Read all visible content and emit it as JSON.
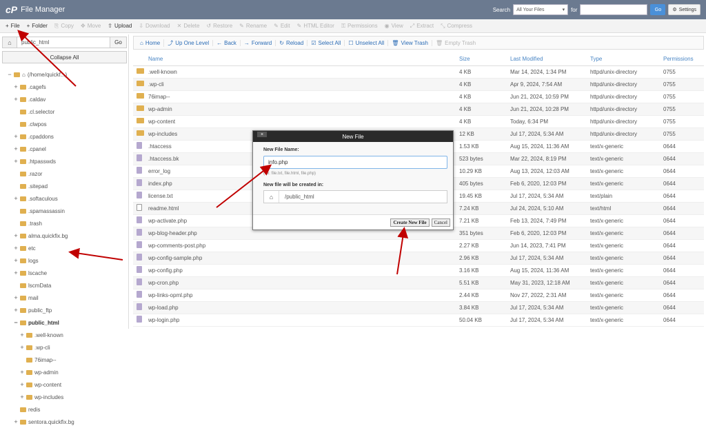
{
  "app": {
    "logo_text": "cP",
    "title": "File Manager"
  },
  "search": {
    "label": "Search",
    "scope": "All Your Files",
    "for_label": "for",
    "go": "Go",
    "settings": "Settings"
  },
  "toolbar": [
    {
      "label": "File",
      "icon": "plus-icon",
      "disabled": false
    },
    {
      "label": "Folder",
      "icon": "plus-icon",
      "disabled": false
    },
    {
      "label": "Copy",
      "icon": "copy-icon",
      "disabled": true
    },
    {
      "label": "Move",
      "icon": "move-icon",
      "disabled": true
    },
    {
      "label": "Upload",
      "icon": "upload-icon",
      "disabled": false
    },
    {
      "label": "Download",
      "icon": "download-icon",
      "disabled": true
    },
    {
      "label": "Delete",
      "icon": "delete-icon",
      "disabled": true
    },
    {
      "label": "Restore",
      "icon": "restore-icon",
      "disabled": true
    },
    {
      "label": "Rename",
      "icon": "rename-icon",
      "disabled": true
    },
    {
      "label": "Edit",
      "icon": "edit-icon",
      "disabled": true
    },
    {
      "label": "HTML Editor",
      "icon": "html-editor-icon",
      "disabled": true
    },
    {
      "label": "Permissions",
      "icon": "key-icon",
      "disabled": true
    },
    {
      "label": "View",
      "icon": "eye-icon",
      "disabled": true
    },
    {
      "label": "Extract",
      "icon": "extract-icon",
      "disabled": true
    },
    {
      "label": "Compress",
      "icon": "compress-icon",
      "disabled": true
    }
  ],
  "left": {
    "path_value": "public_html",
    "go": "Go",
    "collapse_all": "Collapse All"
  },
  "tree": [
    {
      "label": "(/home/quickf...)",
      "level": 0,
      "toggle": "−",
      "bold": false,
      "home": true
    },
    {
      "label": ".cagefs",
      "level": 1,
      "toggle": "+"
    },
    {
      "label": ".caldav",
      "level": 1,
      "toggle": "+"
    },
    {
      "label": ".cl.selector",
      "level": 1,
      "toggle": ""
    },
    {
      "label": ".clwpos",
      "level": 1,
      "toggle": ""
    },
    {
      "label": ".cpaddons",
      "level": 1,
      "toggle": "+"
    },
    {
      "label": ".cpanel",
      "level": 1,
      "toggle": "+"
    },
    {
      "label": ".htpasswds",
      "level": 1,
      "toggle": "+"
    },
    {
      "label": ".razor",
      "level": 1,
      "toggle": ""
    },
    {
      "label": ".sitepad",
      "level": 1,
      "toggle": ""
    },
    {
      "label": ".softaculous",
      "level": 1,
      "toggle": "+"
    },
    {
      "label": ".spamassassin",
      "level": 1,
      "toggle": ""
    },
    {
      "label": ".trash",
      "level": 1,
      "toggle": ""
    },
    {
      "label": "alma.quickfix.bg",
      "level": 1,
      "toggle": "+"
    },
    {
      "label": "etc",
      "level": 1,
      "toggle": "+"
    },
    {
      "label": "logs",
      "level": 1,
      "toggle": "+"
    },
    {
      "label": "lscache",
      "level": 1,
      "toggle": "+"
    },
    {
      "label": "lscmData",
      "level": 1,
      "toggle": ""
    },
    {
      "label": "mail",
      "level": 1,
      "toggle": "+"
    },
    {
      "label": "public_ftp",
      "level": 1,
      "toggle": "+"
    },
    {
      "label": "public_html",
      "level": 1,
      "toggle": "−",
      "bold": true
    },
    {
      "label": ".well-known",
      "level": 2,
      "toggle": "+"
    },
    {
      "label": ".wp-cli",
      "level": 2,
      "toggle": "+"
    },
    {
      "label": "76imap--",
      "level": 2,
      "toggle": ""
    },
    {
      "label": "wp-admin",
      "level": 2,
      "toggle": "+"
    },
    {
      "label": "wp-content",
      "level": 2,
      "toggle": "+"
    },
    {
      "label": "wp-includes",
      "level": 2,
      "toggle": "+"
    },
    {
      "label": "redis",
      "level": 1,
      "toggle": ""
    },
    {
      "label": "sentora.quickfix.bg",
      "level": 1,
      "toggle": "+"
    }
  ],
  "nav": [
    {
      "label": "Home",
      "icon": "home-icon",
      "disabled": false
    },
    {
      "label": "Up One Level",
      "icon": "up-level-icon",
      "disabled": false
    },
    {
      "label": "Back",
      "icon": "back-icon",
      "disabled": false
    },
    {
      "label": "Forward",
      "icon": "forward-icon",
      "disabled": false
    },
    {
      "label": "Reload",
      "icon": "reload-icon",
      "disabled": false
    },
    {
      "label": "Select All",
      "icon": "checkbox-checked-icon",
      "disabled": false
    },
    {
      "label": "Unselect All",
      "icon": "checkbox-icon",
      "disabled": false
    },
    {
      "label": "View Trash",
      "icon": "trash-icon",
      "disabled": false
    },
    {
      "label": "Empty Trash",
      "icon": "trash-icon",
      "disabled": true
    }
  ],
  "table": {
    "columns": [
      "Name",
      "Size",
      "Last Modified",
      "Type",
      "Permissions"
    ],
    "rows": [
      {
        "icon": "folder",
        "name": ".well-known",
        "size": "4 KB",
        "modified": "Mar 14, 2024, 1:34 PM",
        "type": "httpd/unix-directory",
        "perm": "0755"
      },
      {
        "icon": "folder",
        "name": ".wp-cli",
        "size": "4 KB",
        "modified": "Apr 9, 2024, 7:54 AM",
        "type": "httpd/unix-directory",
        "perm": "0755"
      },
      {
        "icon": "folder",
        "name": "76imap--",
        "size": "4 KB",
        "modified": "Jun 21, 2024, 10:59 PM",
        "type": "httpd/unix-directory",
        "perm": "0755"
      },
      {
        "icon": "folder",
        "name": "wp-admin",
        "size": "4 KB",
        "modified": "Jun 21, 2024, 10:28 PM",
        "type": "httpd/unix-directory",
        "perm": "0755"
      },
      {
        "icon": "folder",
        "name": "wp-content",
        "size": "4 KB",
        "modified": "Today, 6:34 PM",
        "type": "httpd/unix-directory",
        "perm": "0755"
      },
      {
        "icon": "folder",
        "name": "wp-includes",
        "size": "12 KB",
        "modified": "Jul 17, 2024, 5:34 AM",
        "type": "httpd/unix-directory",
        "perm": "0755"
      },
      {
        "icon": "file",
        "name": ".htaccess",
        "size": "1.53 KB",
        "modified": "Aug 15, 2024, 11:36 AM",
        "type": "text/x-generic",
        "perm": "0644"
      },
      {
        "icon": "file",
        "name": ".htaccess.bk",
        "size": "523 bytes",
        "modified": "Mar 22, 2024, 8:19 PM",
        "type": "text/x-generic",
        "perm": "0644"
      },
      {
        "icon": "file",
        "name": "error_log",
        "size": "10.29 KB",
        "modified": "Aug 13, 2024, 12:03 AM",
        "type": "text/x-generic",
        "perm": "0644"
      },
      {
        "icon": "file",
        "name": "index.php",
        "size": "405 bytes",
        "modified": "Feb 6, 2020, 12:03 PM",
        "type": "text/x-generic",
        "perm": "0644"
      },
      {
        "icon": "file",
        "name": "license.txt",
        "size": "19.45 KB",
        "modified": "Jul 17, 2024, 5:34 AM",
        "type": "text/plain",
        "perm": "0644"
      },
      {
        "icon": "html",
        "name": "readme.html",
        "size": "7.24 KB",
        "modified": "Jul 24, 2024, 5:10 AM",
        "type": "text/html",
        "perm": "0644"
      },
      {
        "icon": "file",
        "name": "wp-activate.php",
        "size": "7.21 KB",
        "modified": "Feb 13, 2024, 7:49 PM",
        "type": "text/x-generic",
        "perm": "0644"
      },
      {
        "icon": "file",
        "name": "wp-blog-header.php",
        "size": "351 bytes",
        "modified": "Feb 6, 2020, 12:03 PM",
        "type": "text/x-generic",
        "perm": "0644"
      },
      {
        "icon": "file",
        "name": "wp-comments-post.php",
        "size": "2.27 KB",
        "modified": "Jun 14, 2023, 7:41 PM",
        "type": "text/x-generic",
        "perm": "0644"
      },
      {
        "icon": "file",
        "name": "wp-config-sample.php",
        "size": "2.96 KB",
        "modified": "Jul 17, 2024, 5:34 AM",
        "type": "text/x-generic",
        "perm": "0644"
      },
      {
        "icon": "file",
        "name": "wp-config.php",
        "size": "3.16 KB",
        "modified": "Aug 15, 2024, 11:36 AM",
        "type": "text/x-generic",
        "perm": "0644"
      },
      {
        "icon": "file",
        "name": "wp-cron.php",
        "size": "5.51 KB",
        "modified": "May 31, 2023, 12:18 AM",
        "type": "text/x-generic",
        "perm": "0644"
      },
      {
        "icon": "file",
        "name": "wp-links-opml.php",
        "size": "2.44 KB",
        "modified": "Nov 27, 2022, 2:31 AM",
        "type": "text/x-generic",
        "perm": "0644"
      },
      {
        "icon": "file",
        "name": "wp-load.php",
        "size": "3.84 KB",
        "modified": "Jul 17, 2024, 5:34 AM",
        "type": "text/x-generic",
        "perm": "0644"
      },
      {
        "icon": "file",
        "name": "wp-login.php",
        "size": "50.04 KB",
        "modified": "Jul 17, 2024, 5:34 AM",
        "type": "text/x-generic",
        "perm": "0644"
      }
    ]
  },
  "modal": {
    "title": "New File",
    "close": "×",
    "name_label": "New File Name:",
    "name_value": "info.php",
    "hint": "(ex: file.txt, file.html, file.php)",
    "created_label": "New file will be created in:",
    "path_value": "/public_html",
    "create_button": "Create New File",
    "cancel_button": "Cancel"
  },
  "colors": {
    "topbar": "#6b7a90",
    "link": "#2a6bb5",
    "annotation_arrow": "#c00000",
    "folder": "#e0b050"
  }
}
